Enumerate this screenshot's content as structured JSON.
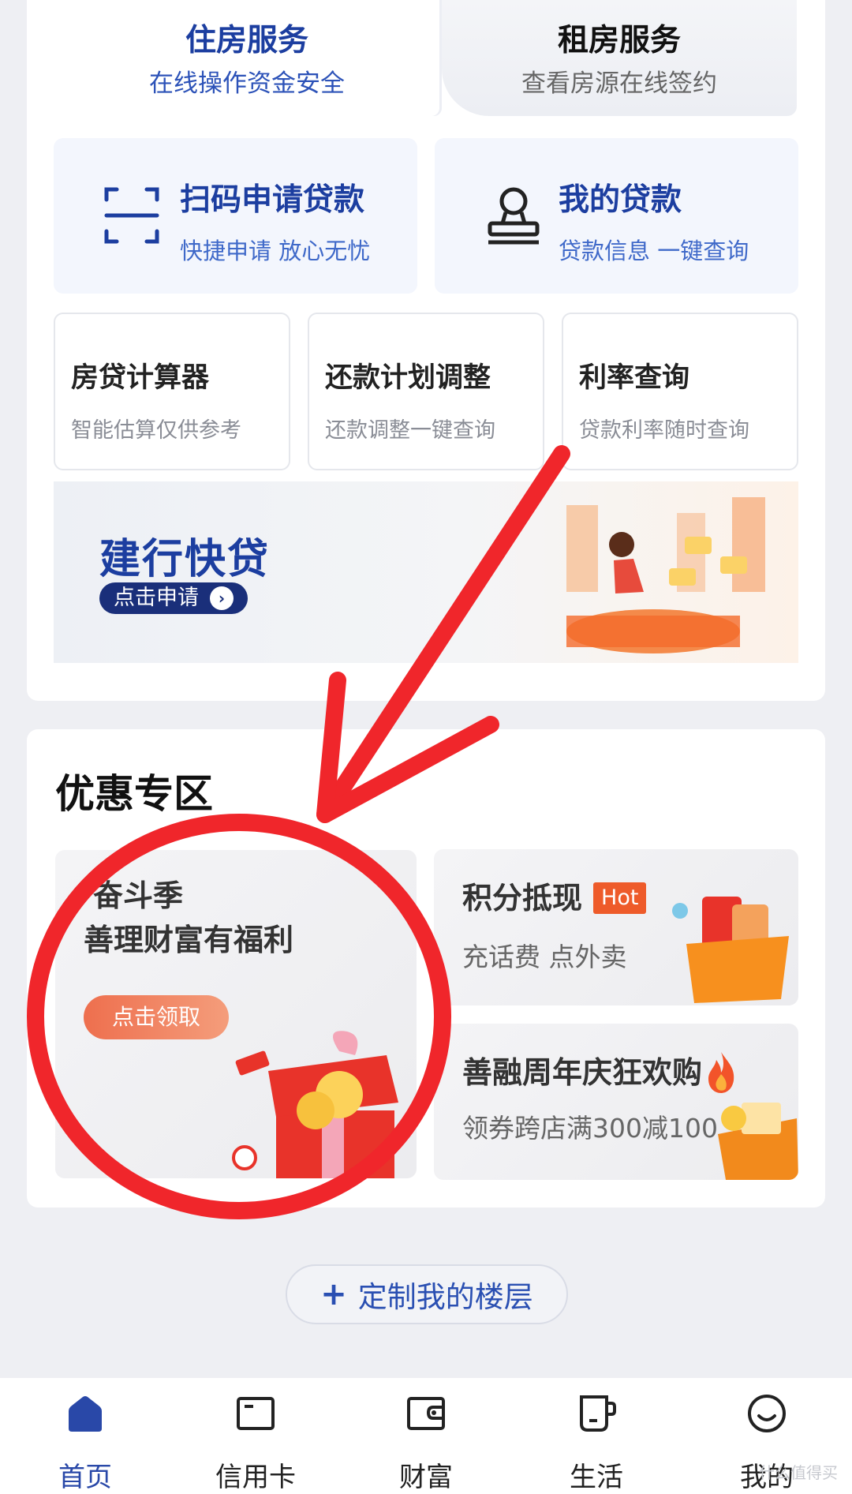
{
  "top_tabs": [
    {
      "title": "住房服务",
      "subtitle": "在线操作资金安全"
    },
    {
      "title": "租房服务",
      "subtitle": "查看房源在线签约"
    }
  ],
  "big_tiles": [
    {
      "title": "扫码申请贷款",
      "subtitle": "快捷申请 放心无忧",
      "icon": "scan-icon"
    },
    {
      "title": "我的贷款",
      "subtitle": "贷款信息 一键查询",
      "icon": "stamp-icon"
    }
  ],
  "small_tiles": [
    {
      "title": "房贷计算器",
      "subtitle": "智能估算仅供参考"
    },
    {
      "title": "还款计划调整",
      "subtitle": "还款调整一键查询"
    },
    {
      "title": "利率查询",
      "subtitle": "贷款利率随时查询"
    }
  ],
  "banner": {
    "title": "建行快贷",
    "button": "点击申请"
  },
  "promo": {
    "heading": "优惠专区",
    "left": {
      "line1": "奋斗季",
      "line2": "善理财富有福利",
      "button": "点击领取"
    },
    "right_top": {
      "title": "积分抵现",
      "badge": "Hot",
      "subtitle": "充话费 点外卖"
    },
    "right_bottom": {
      "title": "善融周年庆狂欢购",
      "subtitle": "领券跨店满300减100"
    }
  },
  "custom_floor": {
    "label": "定制我的楼层"
  },
  "tabbar": [
    {
      "label": "首页",
      "icon": "home-icon",
      "active": true
    },
    {
      "label": "信用卡",
      "icon": "credit-card-icon",
      "active": false
    },
    {
      "label": "财富",
      "icon": "wallet-icon",
      "active": false
    },
    {
      "label": "生活",
      "icon": "cup-icon",
      "active": false
    },
    {
      "label": "我的",
      "icon": "smile-icon",
      "active": false
    }
  ],
  "colors": {
    "brand": "#1c3ea0",
    "accent_orange": "#ee5b2a",
    "annotation_red": "#f0262b"
  },
  "watermark": "什么值得买"
}
